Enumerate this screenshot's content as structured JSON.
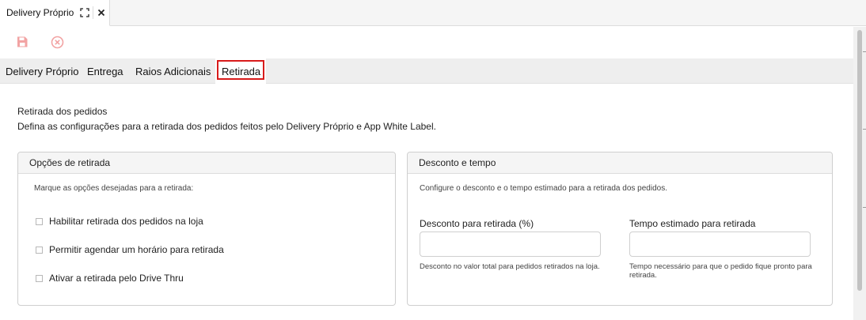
{
  "doc_tab": {
    "title": "Delivery Próprio"
  },
  "tabs": [
    {
      "label": "Delivery Próprio"
    },
    {
      "label": "Entrega"
    },
    {
      "label": "Raios Adicionais"
    },
    {
      "label": "Retirada"
    }
  ],
  "section": {
    "title": "Retirada dos pedidos",
    "description": "Defina as configurações para a retirada dos pedidos feitos pelo Delivery Próprio e App White Label."
  },
  "options_panel": {
    "header": "Opções de retirada",
    "hint": "Marque as opções desejadas para a retirada:",
    "options": [
      {
        "label": "Habilitar retirada dos pedidos na loja",
        "checked": false
      },
      {
        "label": "Permitir agendar um horário para retirada",
        "checked": false
      },
      {
        "label": "Ativar a retirada pelo Drive Thru",
        "checked": false
      }
    ]
  },
  "discount_panel": {
    "header": "Desconto e tempo",
    "hint": "Configure o desconto e o tempo estimado para a retirada dos pedidos.",
    "discount": {
      "label": "Desconto para retirada (%)",
      "value": "",
      "help": "Desconto no valor total para pedidos retirados na loja."
    },
    "time": {
      "label": "Tempo estimado para retirada",
      "value": "",
      "help": "Tempo necessário para que o pedido fique pronto para retirada."
    }
  },
  "icons": {
    "save": "save-icon",
    "cancel": "cancel-icon",
    "expand": "expand-icon",
    "close": "close-icon"
  },
  "colors": {
    "toolbar_icon": "#f2a3a3",
    "active_tab_outline": "#d81b1b"
  }
}
